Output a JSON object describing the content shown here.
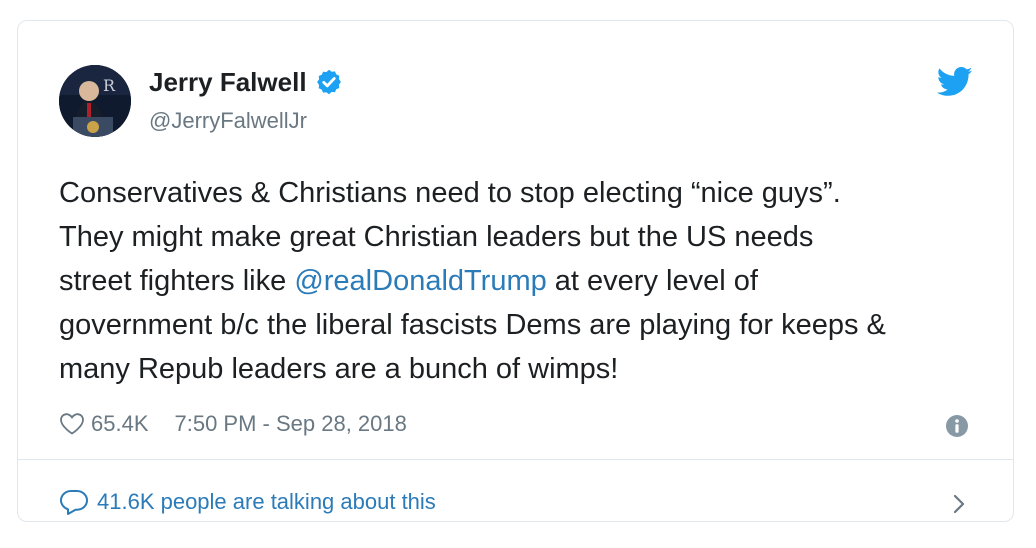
{
  "author": {
    "name": "Jerry Falwell",
    "handle": "@JerryFalwellJr",
    "verified": true
  },
  "tweet": {
    "lines": [
      {
        "text": "Conservatives & Christians need to stop electing “nice guys”."
      },
      {
        "text": "They might make great Christian leaders but the US needs"
      },
      {
        "pre": "street fighters like ",
        "mention": "@realDonaldTrump",
        "post": " at every level of"
      },
      {
        "text": "government b/c the liberal fascists Dems are playing for keeps &"
      },
      {
        "text": "many Repub leaders are a bunch of wimps!"
      }
    ]
  },
  "meta": {
    "likes": "65.4K",
    "timestamp": "7:50 PM - Sep 28, 2018"
  },
  "footer": {
    "talking": "41.6K people are talking about this"
  },
  "colors": {
    "text": "#1c2022",
    "secondary": "#697882",
    "link": "#2b7bb9",
    "verified": "#1da1f2",
    "twitter_bird": "#1da1f2",
    "border": "#e1e8ed"
  },
  "icons": [
    "verified-badge-icon",
    "twitter-bird-icon",
    "heart-icon",
    "info-icon",
    "speech-bubble-icon",
    "chevron-right-icon"
  ]
}
